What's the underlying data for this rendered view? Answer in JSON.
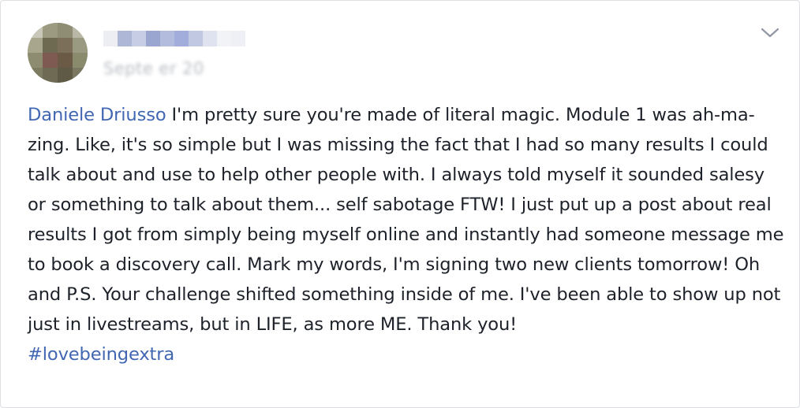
{
  "post": {
    "author_name": "",
    "timestamp": "Septe   er 20",
    "mention": "Daniele Driusso",
    "text": " I'm pretty sure you're made of literal magic. Module 1 was ah-ma-zing. Like, it's so simple but I was missing the fact that I had so many results I could talk about and use to help other people with. I always told myself it sounded salesy or something to talk about them... self sabotage FTW! I just put up a post about real results I got from simply being myself online and instantly had someone message me to book a discovery call. Mark my words, I'm signing two new clients tomorrow! Oh and P.S. Your challenge shifted something inside of me. I've been able to show up not just in livestreams, but in LIFE, as more ME. Thank you!",
    "hashtag": "#lovebeingextra"
  },
  "icons": {
    "options": "chevron-down-icon",
    "avatar": "avatar-pixelated"
  },
  "colors": {
    "link": "#4267b2",
    "text": "#1d2129",
    "muted": "#b8bcc3",
    "border": "#dddfe2"
  }
}
